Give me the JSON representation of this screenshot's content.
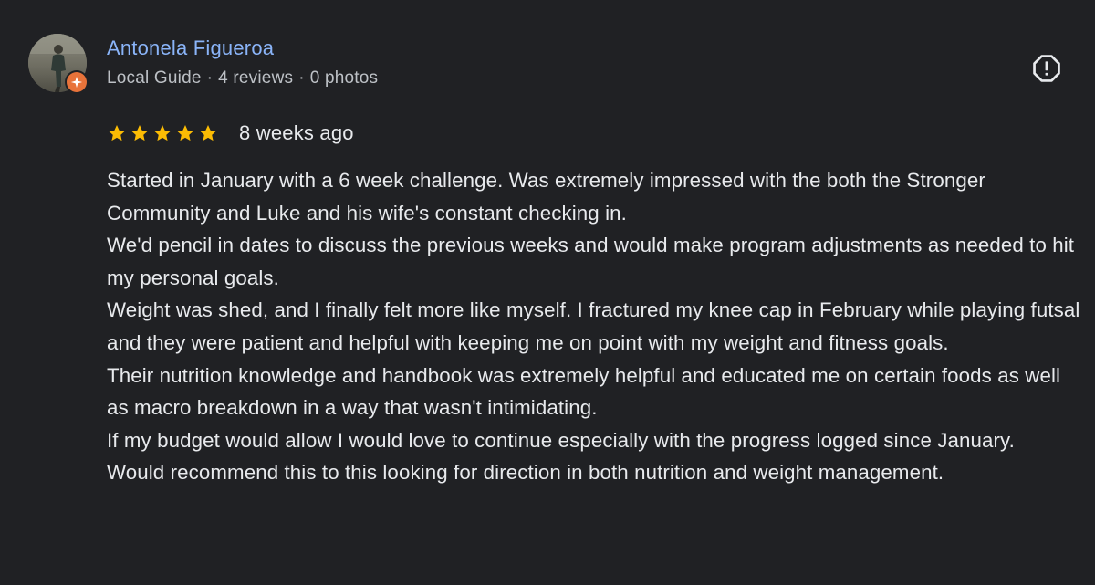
{
  "reviewer": {
    "name": "Antonela Figueroa",
    "badge_icon": "local-guide-icon",
    "meta": {
      "role": "Local Guide",
      "reviews": "4 reviews",
      "photos": "0 photos",
      "separator": "·"
    }
  },
  "rating": {
    "stars": 5,
    "max": 5,
    "star_color": "#fbbc04",
    "time": "8 weeks ago"
  },
  "report_icon": "report-icon",
  "body": [
    "Started in January with a 6 week challenge. Was extremely impressed with the both the Stronger Community and Luke and his wife's constant checking in.",
    "We'd pencil in dates to discuss the previous weeks and would make program adjustments as needed to hit my personal goals.",
    "Weight was shed, and I finally felt more like myself. I fractured my knee cap in February while playing futsal and they were patient and helpful with keeping me on point with my weight and fitness goals.",
    "Their nutrition knowledge and handbook was extremely helpful and educated me on certain foods as well as macro breakdown in a way that wasn't intimidating.",
    "If my budget would allow I would love to continue especially with the progress logged since January.",
    "Would recommend this to this looking for direction in both nutrition and weight management."
  ],
  "colors": {
    "background": "#202124",
    "name": "#8ab4f8",
    "meta": "#bdc1c6",
    "text": "#e8eaed",
    "badge": "#e8733a"
  }
}
